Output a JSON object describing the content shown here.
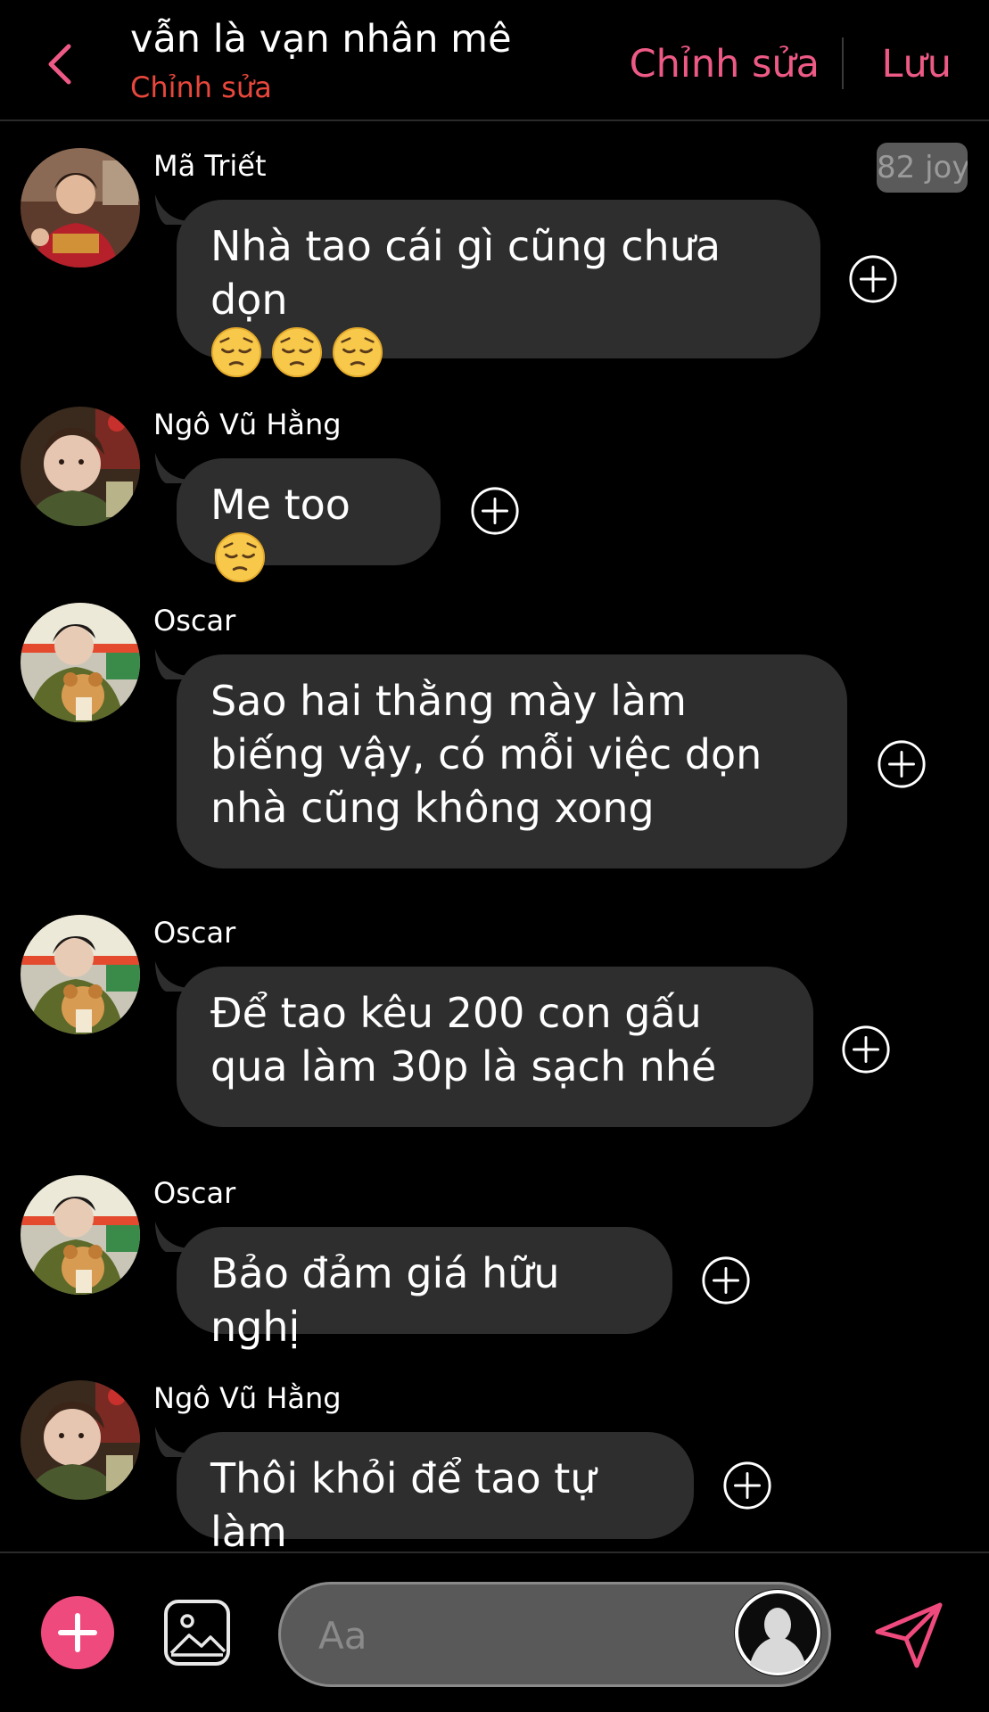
{
  "header": {
    "title": "vẫn là vạn nhân mê",
    "subtitle": "Chỉnh sửa",
    "edit_label": "Chỉnh sửa",
    "save_label": "Lưu"
  },
  "colors": {
    "accent": "#ee5a86",
    "subtitle": "#e8473c",
    "bubble": "#2e2e2e",
    "background": "#000000"
  },
  "messages": [
    {
      "sender": "Mã Triết",
      "text": "Nhà tao cái gì cũng chưa dọn",
      "emoji": [
        "pensive-face",
        "pensive-face",
        "pensive-face"
      ],
      "badge": "82 joy"
    },
    {
      "sender": "Ngô Vũ Hằng",
      "text": "Me too",
      "emoji": [
        "pensive-face"
      ]
    },
    {
      "sender": "Oscar",
      "text": "Sao hai thằng mày làm biếng vậy, có mỗi việc dọn nhà cũng không xong"
    },
    {
      "sender": "Oscar",
      "text": "Để tao kêu 200 con gấu qua làm 30p là sạch nhé"
    },
    {
      "sender": "Oscar",
      "text": "Bảo đảm giá hữu nghị"
    },
    {
      "sender": "Ngô Vũ Hằng",
      "text": "Thôi khỏi để tao tự làm"
    }
  ],
  "composer": {
    "placeholder": "Aa"
  },
  "icons": {
    "back": "chevron-left-icon",
    "add_reaction": "plus-circle-icon",
    "add": "plus-icon",
    "image": "image-icon",
    "avatar": "user-silhouette-icon",
    "send": "send-icon"
  }
}
